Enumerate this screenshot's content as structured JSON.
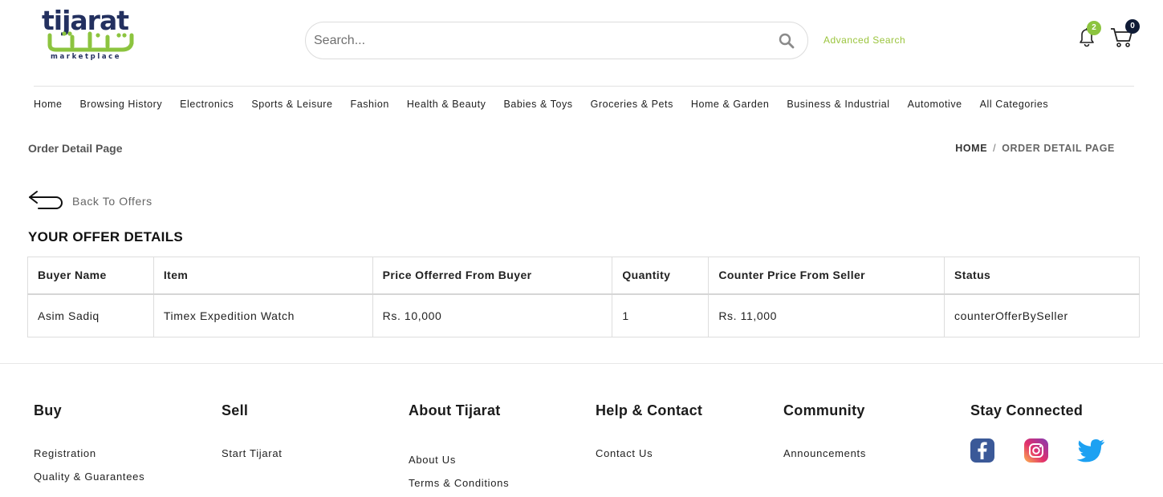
{
  "logo": {
    "en": "tijarat",
    "ar": "تجارت",
    "sub": "marketplace"
  },
  "search": {
    "placeholder": "Search...",
    "value": ""
  },
  "advanced_search": "Advanced Search",
  "notifications": {
    "count": "2"
  },
  "cart": {
    "count": "0"
  },
  "nav": {
    "items": [
      "Home",
      "Browsing History",
      "Electronics",
      "Sports & Leisure",
      "Fashion",
      "Health & Beauty",
      "Babies & Toys",
      "Groceries & Pets",
      "Home & Garden",
      "Business & Industrial",
      "Automotive",
      "All Categories"
    ]
  },
  "page": {
    "title": "Order Detail Page",
    "breadcrumb": {
      "home": "HOME",
      "separator": "/",
      "current": "ORDER DETAIL PAGE"
    },
    "back_label": "Back To Offers",
    "section_title": "YOUR OFFER DETAILS"
  },
  "table": {
    "headers": [
      "Buyer Name",
      "Item",
      "Price Offerred From Buyer",
      "Quantity",
      "Counter Price From Seller",
      "Status"
    ],
    "rows": [
      [
        "Asim Sadiq",
        "Timex Expedition Watch",
        "Rs. 10,000",
        "1",
        "Rs. 11,000",
        "counterOfferBySeller"
      ]
    ]
  },
  "footer": {
    "columns": [
      {
        "heading": "Buy",
        "links": [
          "Registration",
          "Quality & Guarantees"
        ]
      },
      {
        "heading": "Sell",
        "links": [
          "Start Tijarat"
        ]
      },
      {
        "heading": "About Tijarat",
        "links": [
          "About Us",
          "Terms & Conditions"
        ]
      },
      {
        "heading": "Help & Contact",
        "links": [
          "Contact Us"
        ]
      },
      {
        "heading": "Community",
        "links": [
          "Announcements"
        ]
      },
      {
        "heading": "Stay Connected",
        "social": [
          "facebook-icon",
          "instagram-icon",
          "twitter-icon"
        ]
      }
    ]
  },
  "colors": {
    "brand_navy": "#23305f",
    "brand_green": "#8cc43f",
    "advanced_search": "#9ac43c",
    "facebook": "#3b5998",
    "twitter": "#1da1f2"
  }
}
